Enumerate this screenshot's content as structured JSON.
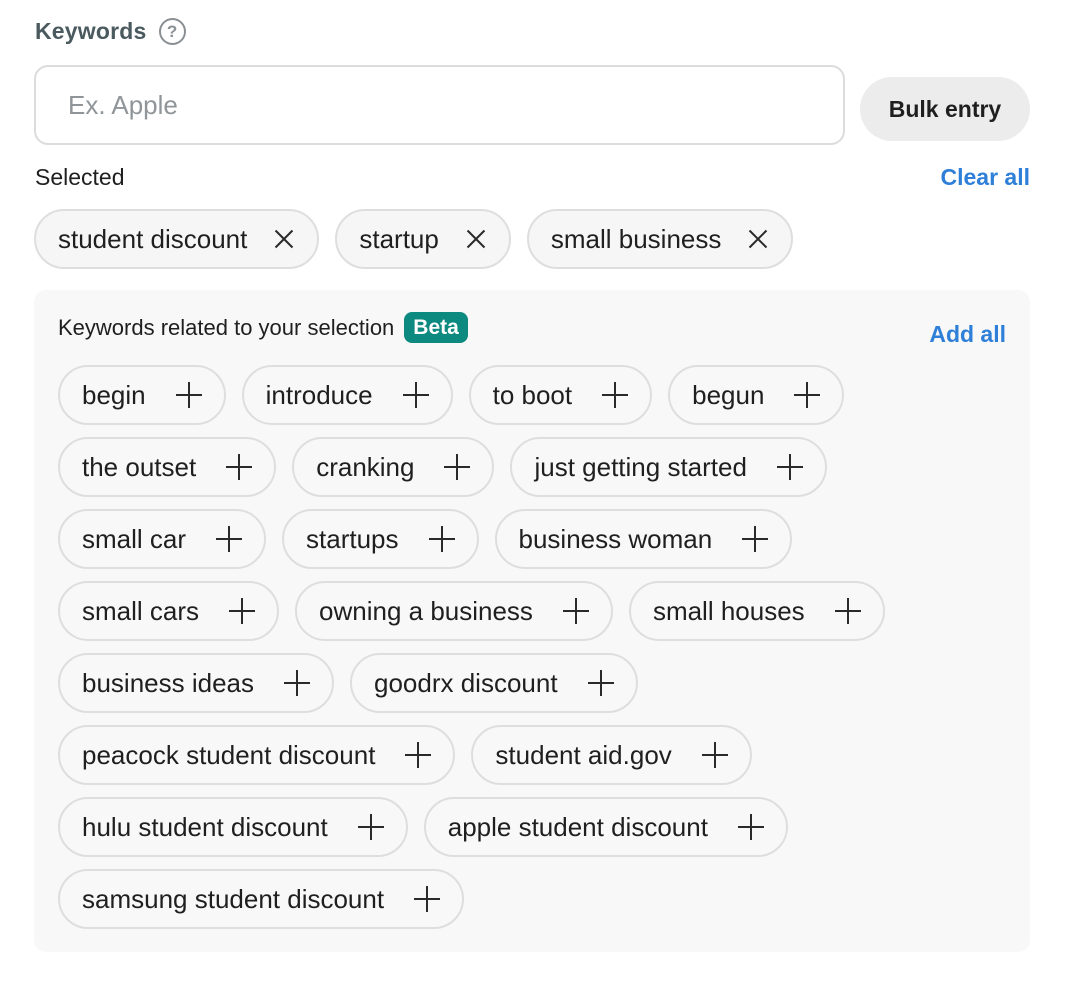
{
  "keywords": {
    "title": "Keywords",
    "help_icon": "?",
    "input_placeholder": "Ex. Apple",
    "bulk_entry_label": "Bulk entry"
  },
  "selected": {
    "label": "Selected",
    "clear_all_label": "Clear all",
    "chips": [
      "student discount",
      "startup",
      "small business"
    ],
    "chip_icon": "close-icon"
  },
  "related": {
    "title": "Keywords related to your selection",
    "badge": "Beta",
    "add_all_label": "Add all",
    "chip_icon": "plus-icon",
    "chips": [
      "begin",
      "introduce",
      "to boot",
      "begun",
      "the outset",
      "cranking",
      "just getting started",
      "small car",
      "startups",
      "business woman",
      "small cars",
      "owning a business",
      "small houses",
      "business ideas",
      "goodrx discount",
      "peacock student discount",
      "student aid.gov",
      "hulu student discount",
      "apple student discount",
      "samsung student discount"
    ]
  },
  "colors": {
    "accent_link": "#2e7fd8",
    "beta_badge": "#0d8a7f",
    "panel_bg": "#f8f8f8"
  }
}
